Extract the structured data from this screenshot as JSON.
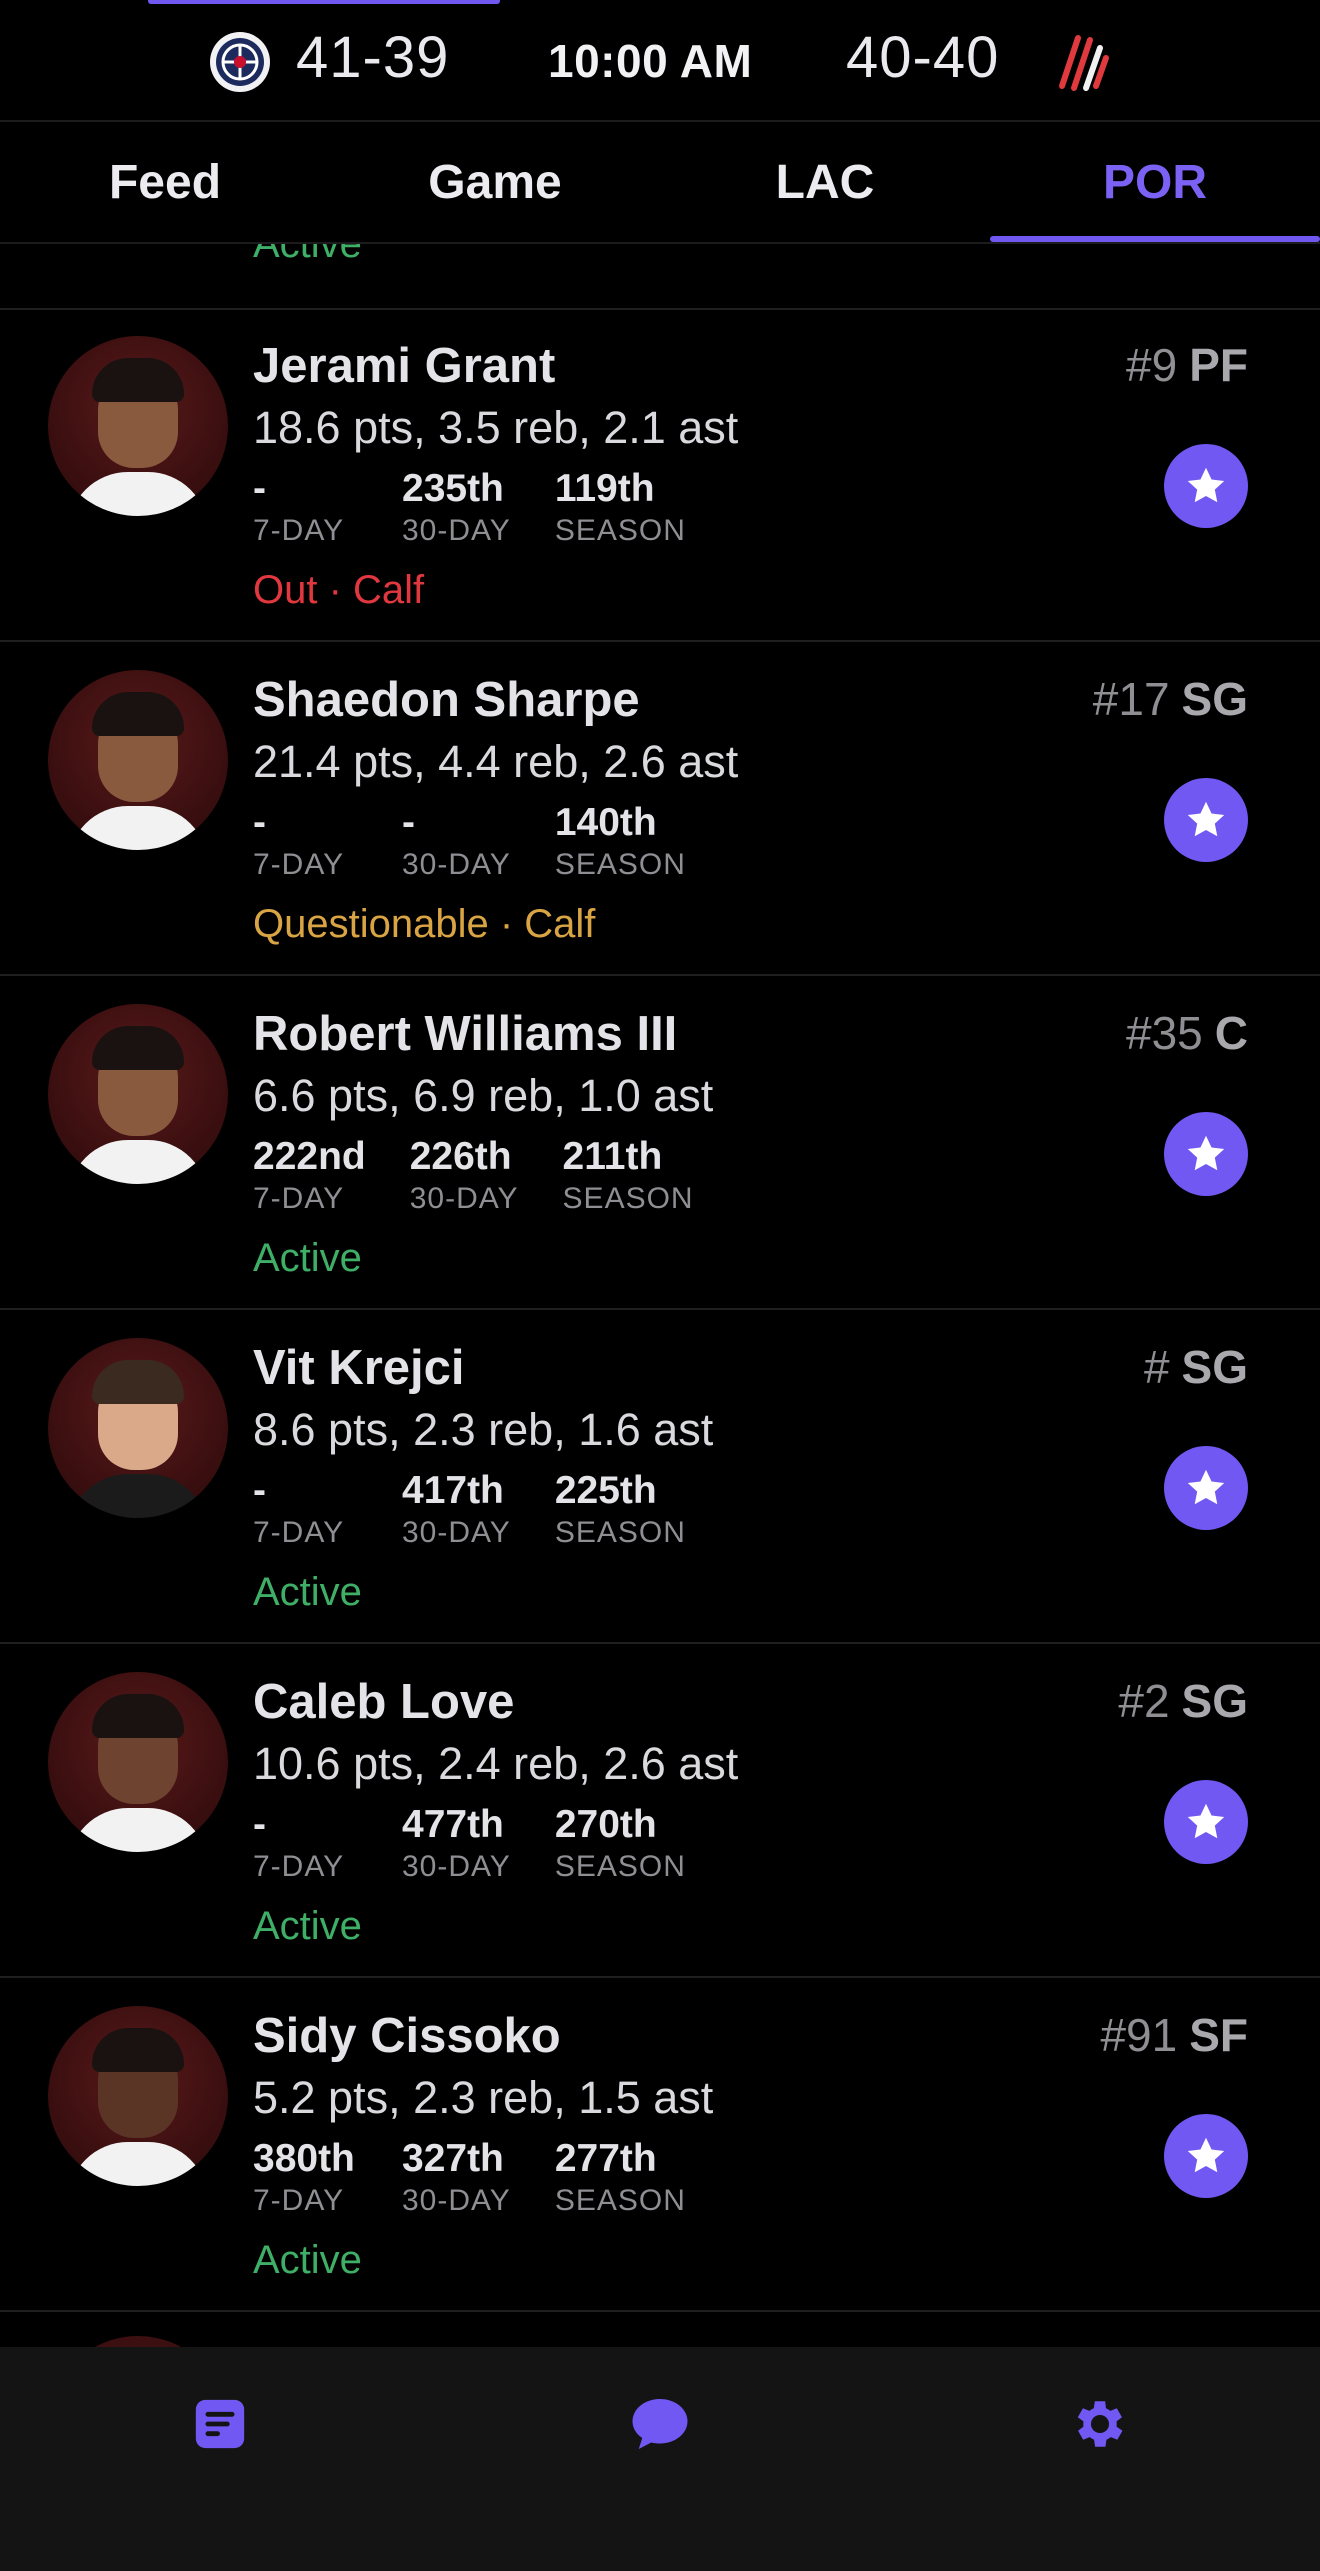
{
  "header": {
    "away_record": "41-39",
    "game_time": "10:00 AM",
    "home_record": "40-40",
    "away_logo_icon": "clippers-logo-icon",
    "home_logo_icon": "blazers-logo-icon"
  },
  "tabs": [
    {
      "label": "Feed",
      "active": false
    },
    {
      "label": "Game",
      "active": false
    },
    {
      "label": "LAC",
      "active": false
    },
    {
      "label": "POR",
      "active": true
    }
  ],
  "partial_top_status": "Active",
  "players": [
    {
      "name": "Jerami Grant",
      "averages": "18.6 pts, 3.5 reb, 2.1 ast",
      "ranks": [
        {
          "value": "-",
          "label": "7-DAY"
        },
        {
          "value": "235th",
          "label": "30-DAY"
        },
        {
          "value": "119th",
          "label": "SEASON"
        }
      ],
      "status": "Out · Calf",
      "status_type": "out",
      "number": "#9",
      "position": "PF"
    },
    {
      "name": "Shaedon Sharpe",
      "averages": "21.4 pts, 4.4 reb, 2.6 ast",
      "ranks": [
        {
          "value": "-",
          "label": "7-DAY"
        },
        {
          "value": "-",
          "label": "30-DAY"
        },
        {
          "value": "140th",
          "label": "SEASON"
        }
      ],
      "status": "Questionable · Calf",
      "status_type": "q",
      "number": "#17",
      "position": "SG"
    },
    {
      "name": "Robert Williams III",
      "averages": "6.6 pts, 6.9 reb, 1.0 ast",
      "ranks": [
        {
          "value": "222nd",
          "label": "7-DAY"
        },
        {
          "value": "226th",
          "label": "30-DAY"
        },
        {
          "value": "211th",
          "label": "SEASON"
        }
      ],
      "status": "Active",
      "status_type": "active",
      "number": "#35",
      "position": "C"
    },
    {
      "name": "Vit Krejci",
      "averages": "8.6 pts, 2.3 reb, 1.6 ast",
      "ranks": [
        {
          "value": "-",
          "label": "7-DAY"
        },
        {
          "value": "417th",
          "label": "30-DAY"
        },
        {
          "value": "225th",
          "label": "SEASON"
        }
      ],
      "status": "Active",
      "status_type": "active",
      "number": "#",
      "position": "SG"
    },
    {
      "name": "Caleb Love",
      "averages": "10.6 pts, 2.4 reb, 2.6 ast",
      "ranks": [
        {
          "value": "-",
          "label": "7-DAY"
        },
        {
          "value": "477th",
          "label": "30-DAY"
        },
        {
          "value": "270th",
          "label": "SEASON"
        }
      ],
      "status": "Active",
      "status_type": "active",
      "number": "#2",
      "position": "SG"
    },
    {
      "name": "Sidy Cissoko",
      "averages": "5.2 pts, 2.3 reb, 1.5 ast",
      "ranks": [
        {
          "value": "380th",
          "label": "7-DAY"
        },
        {
          "value": "327th",
          "label": "30-DAY"
        },
        {
          "value": "277th",
          "label": "SEASON"
        }
      ],
      "status": "Active",
      "status_type": "active",
      "number": "#91",
      "position": "SF"
    }
  ],
  "bottom_nav": [
    {
      "icon": "feed-icon"
    },
    {
      "icon": "chat-bubble-icon"
    },
    {
      "icon": "gear-icon"
    }
  ],
  "colors": {
    "accent": "#7158f2",
    "active": "#3fae66",
    "out": "#e0383e",
    "questionable": "#d9a443"
  }
}
